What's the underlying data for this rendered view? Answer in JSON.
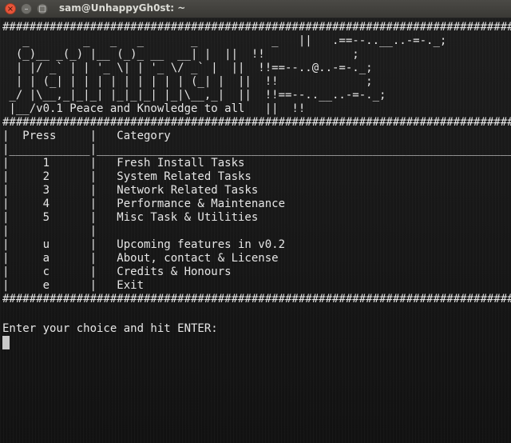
{
  "window": {
    "title": "sam@UnhappyGh0st: ~",
    "close_glyph": "×",
    "minimize_glyph": "–",
    "maximize_glyph": "□",
    "close_color": "#e8553a"
  },
  "terminal": {
    "lines": [
      "###############################################################################",
      "   _        _   _   _       _           _   ||   .==--..__..-=-._;",
      "  (_)__ _(_) |__ (_)_ __  __| |  ||  !!             ;",
      "  | |/ _` | | '_ \\| | '_ \\/ _` |  ||  !!==--..@..-=-._;",
      "  | | (_| | | | | | | | | | (_| |  ||  !!             ;",
      " _/ |\\__,_|_|_| |_|_|_| |_|\\__,_|  ||  !!==--..__..-=-._;",
      " |__/v0.1 Peace and Knowledge to all   ||  !!",
      "###############################################################################",
      "|  Press     |   Category",
      "|____________|_________________________________________________________________",
      "|     1      |   Fresh Install Tasks",
      "|     2      |   System Related Tasks",
      "|     3      |   Network Related Tasks",
      "|     4      |   Performance & Maintenance",
      "|     5      |   Misc Task & Utilities",
      "|            |",
      "|     u      |   Upcoming features in v0.2",
      "|     a      |   About, contact & License",
      "|     c      |   Credits & Honours",
      "|     e      |   Exit",
      "###############################################################################",
      "",
      "Enter your choice and hit ENTER:"
    ],
    "text_color": "#e6e6e6",
    "background_color": "#141414",
    "cursor_color": "#c9c9c9"
  }
}
